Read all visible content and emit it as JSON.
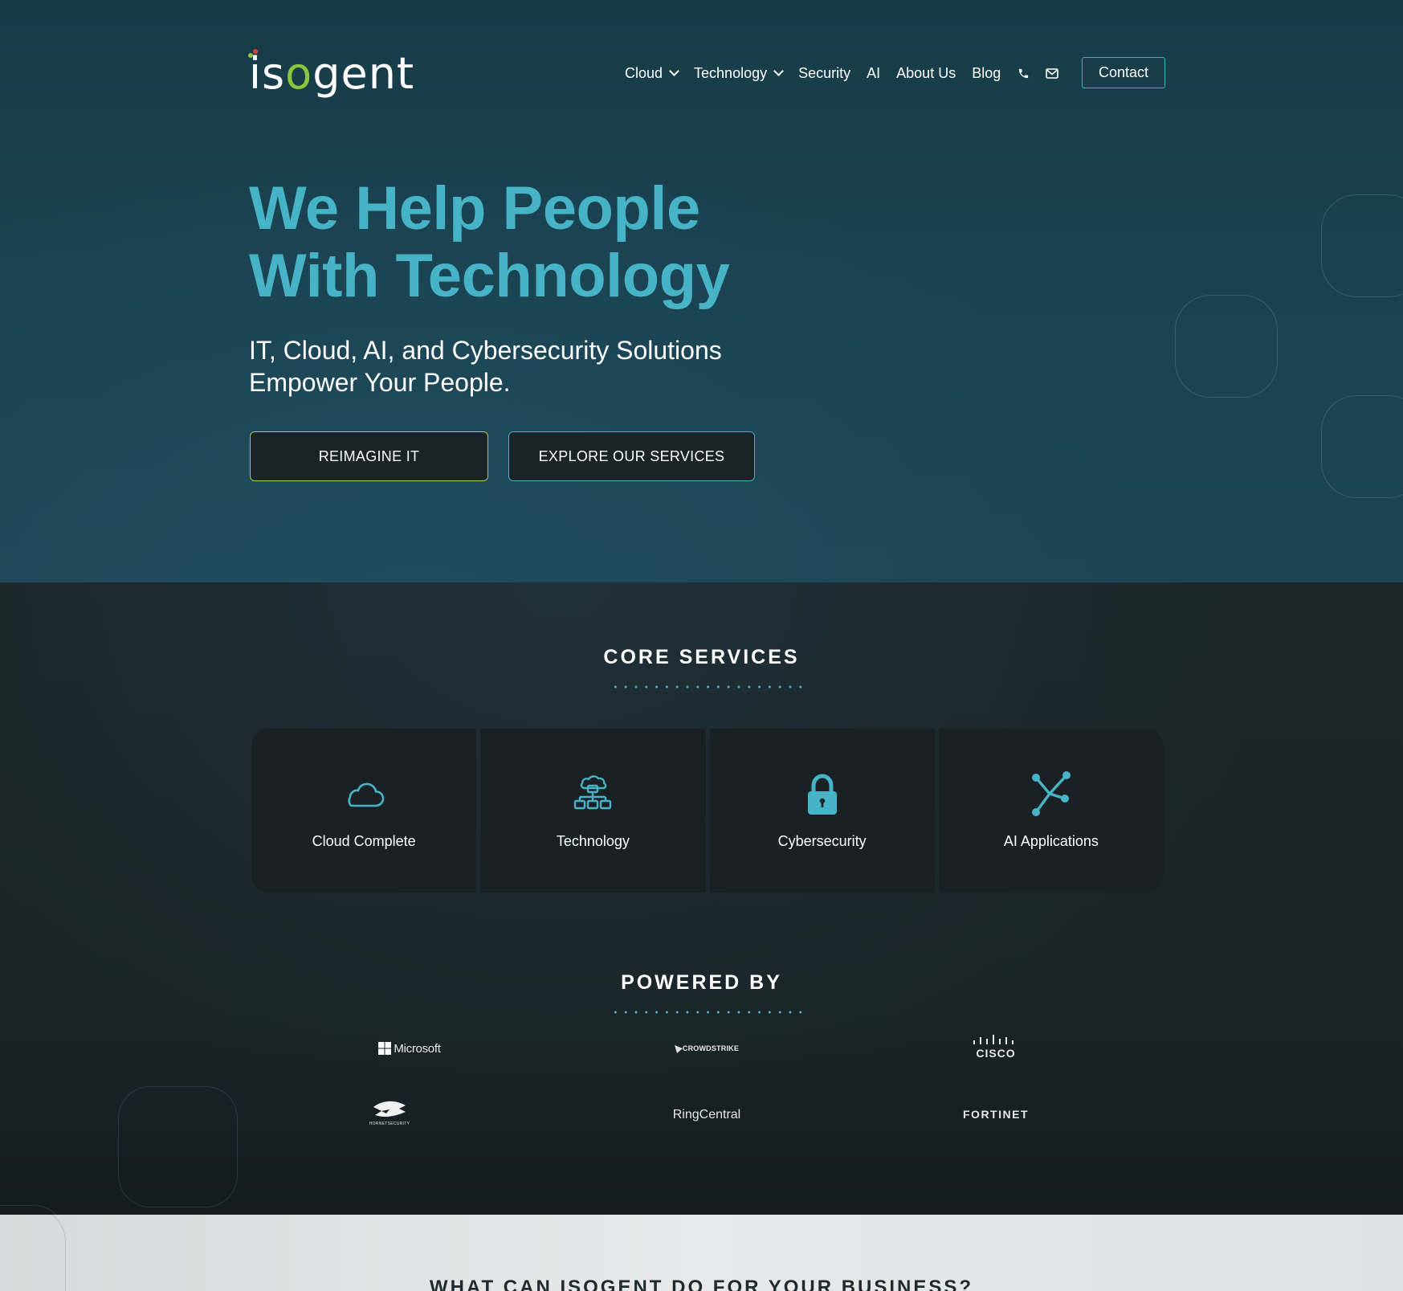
{
  "brand": {
    "name_prefix": "is",
    "name_o": "o",
    "name_suffix": "gent"
  },
  "nav": {
    "items": [
      {
        "label": "Cloud",
        "dropdown": true
      },
      {
        "label": "Technology",
        "dropdown": true
      },
      {
        "label": "Security",
        "dropdown": false
      },
      {
        "label": "AI",
        "dropdown": false
      },
      {
        "label": "About Us",
        "dropdown": false
      },
      {
        "label": "Blog",
        "dropdown": false
      }
    ],
    "icons": [
      "phone-icon",
      "mail-icon"
    ],
    "contact_label": "Contact"
  },
  "hero": {
    "headline_line1": "We Help People",
    "headline_line2": "With Technology",
    "sub_line1": "IT, Cloud, AI, and Cybersecurity Solutions",
    "sub_line2": "Empower Your People.",
    "primary_cta": "REIMAGINE IT",
    "secondary_cta": "EXPLORE OUR SERVICES"
  },
  "core_services": {
    "title": "CORE SERVICES",
    "cards": [
      {
        "label": "Cloud Complete",
        "icon": "cloud-icon"
      },
      {
        "label": "Technology",
        "icon": "network-icon"
      },
      {
        "label": "Cybersecurity",
        "icon": "lock-icon"
      },
      {
        "label": "AI Applications",
        "icon": "ai-nodes-icon"
      }
    ]
  },
  "powered_by": {
    "title": "POWERED BY",
    "partners": [
      "Microsoft",
      "CROWDSTRIKE",
      "CISCO",
      "HORNETSECURITY",
      "RingCentral",
      "FORTINET"
    ]
  },
  "next_section": {
    "title": "WHAT CAN ISOGENT DO FOR YOUR BUSINESS?"
  },
  "colors": {
    "accent": "#47b3c6",
    "green": "#a6cd4e",
    "red_dot": "#e53e2e"
  }
}
